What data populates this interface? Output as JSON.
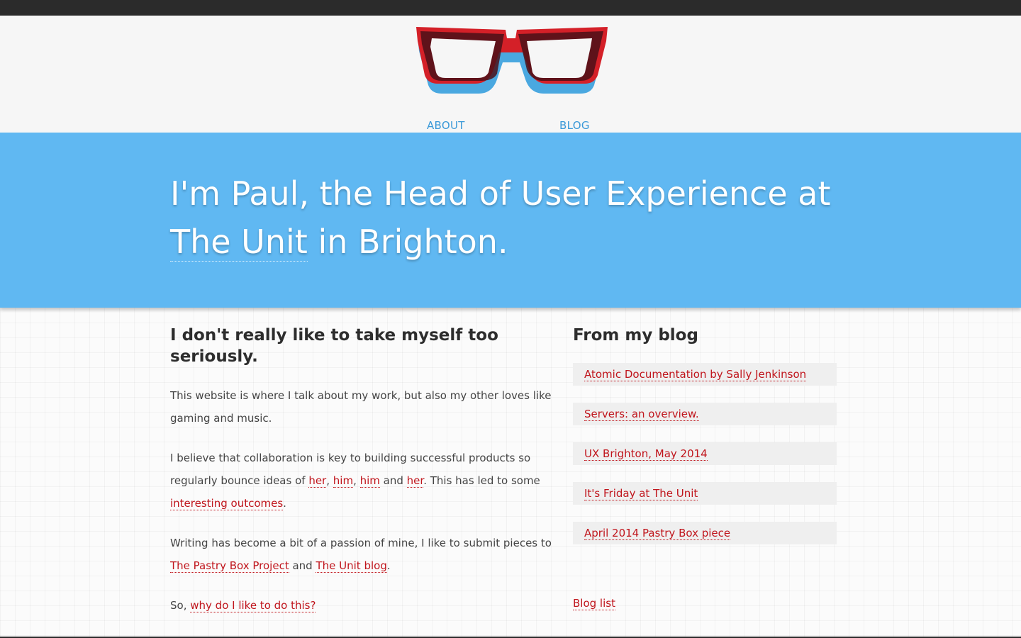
{
  "nav": {
    "about": "ABOUT",
    "blog": "BLOG"
  },
  "hero": {
    "intro": "I'm Paul, the Head of User Experience at",
    "company_link": "The Unit",
    "suffix": " in Brighton."
  },
  "about": {
    "heading": "I don't really like to take myself too seriously.",
    "p1": "This website is where I talk about my work, but also my other loves like gaming and music.",
    "p2_start": "I believe that collaboration is key to building successful products so regularly bounce ideas of ",
    "links_people": [
      "her",
      "him",
      "him",
      "her"
    ],
    "p2_sep1": ", ",
    "p2_sep2": ", ",
    "p2_and": " and ",
    "p2_end": ". This has led to some ",
    "p2_link": "interesting outcomes",
    "p2_period": ".",
    "p3_start": "Writing has become a bit of a passion of mine, I like to submit pieces to ",
    "p3_link1": "The Pastry Box Project",
    "p3_and": " and ",
    "p3_link2": "The Unit blog",
    "p3_period": ".",
    "p4_start": "So, ",
    "p4_link": "why do I like to do this?"
  },
  "blog": {
    "heading": "From my blog",
    "items": [
      "Atomic Documentation by Sally Jenkinson",
      "Servers: an overview.",
      "UX Brighton, May 2014",
      "It's Friday at The Unit",
      "April 2014 Pastry Box piece"
    ],
    "list_link": "Blog list"
  },
  "colors": {
    "hero_bg": "#60b8f2",
    "link_red": "#c0151c",
    "nav_blue": "#3a99d8"
  }
}
